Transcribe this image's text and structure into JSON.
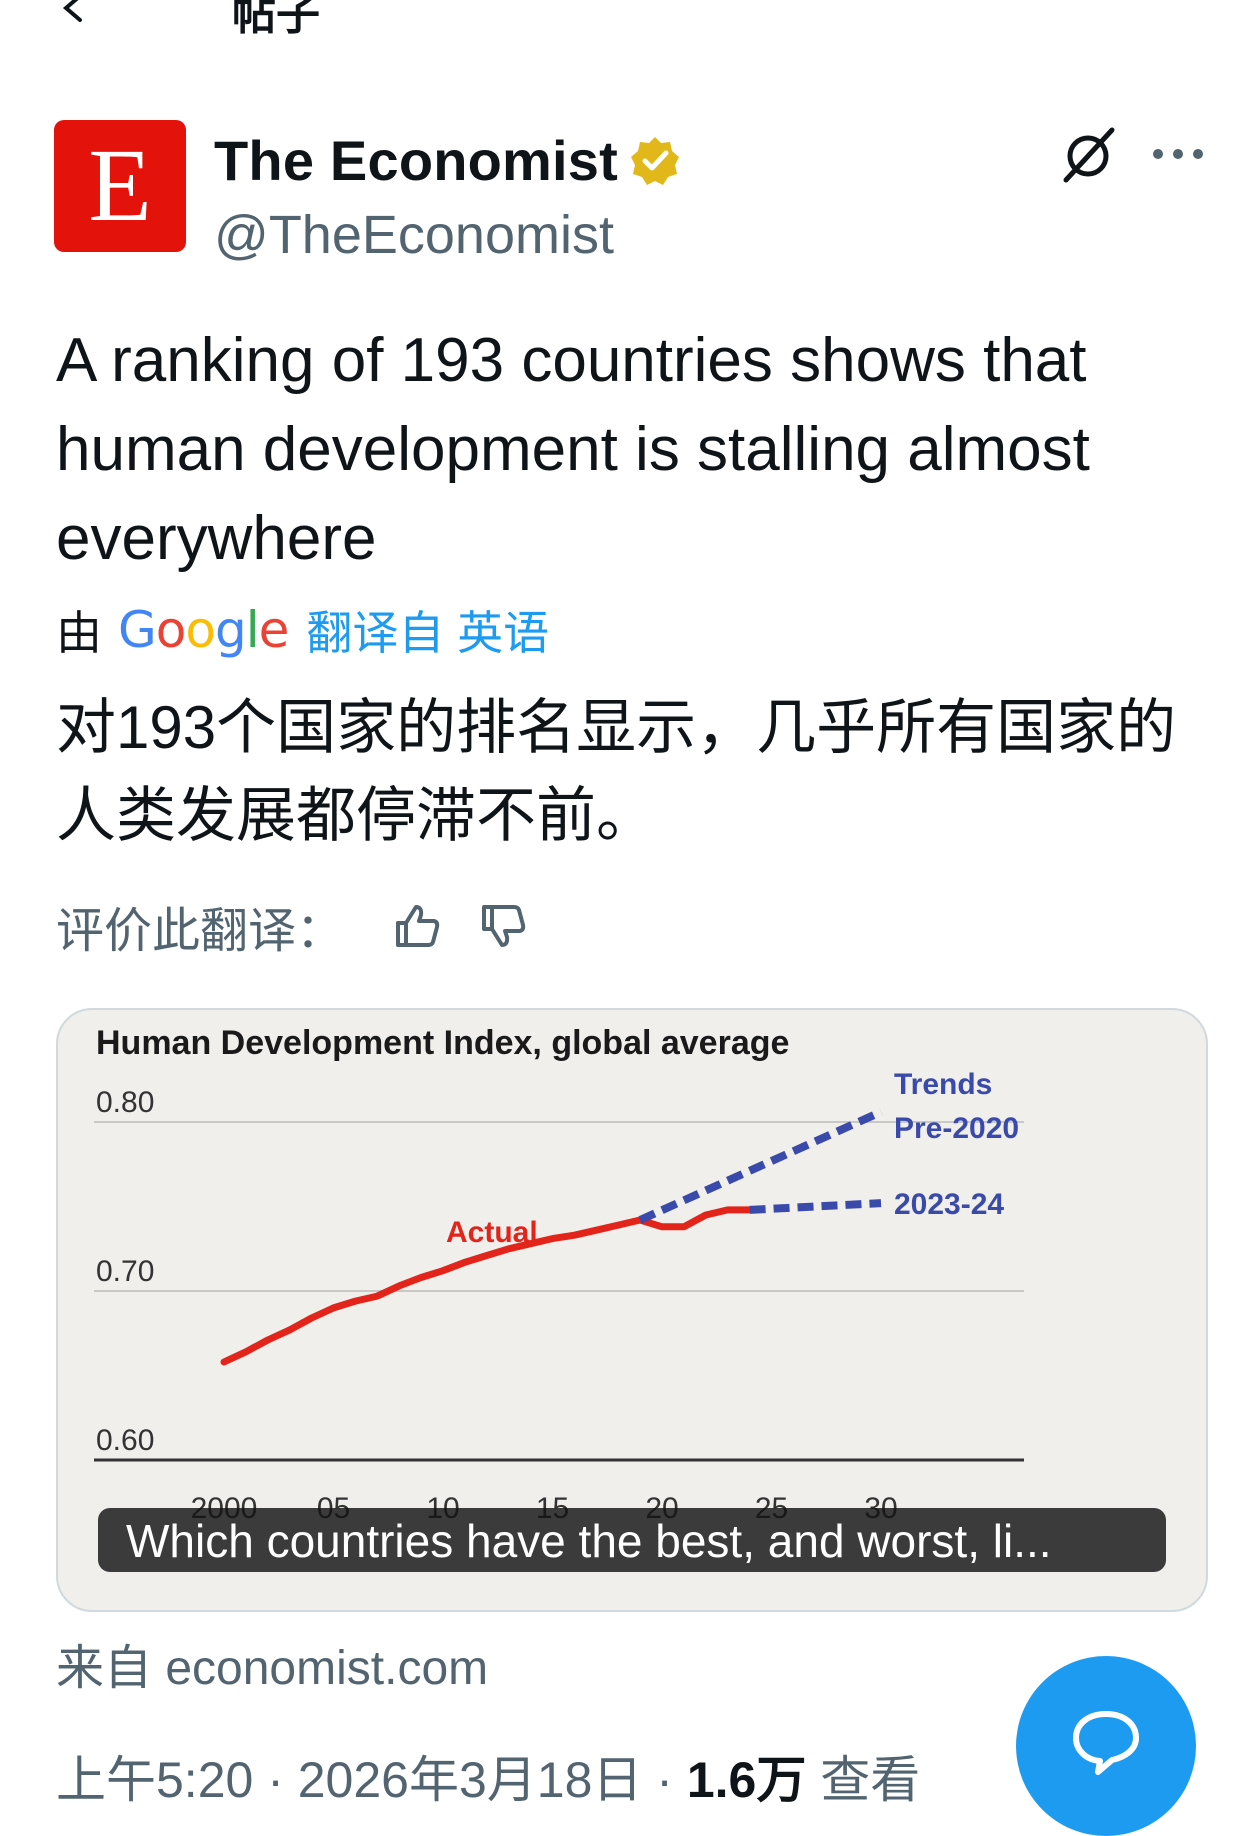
{
  "topbar": {
    "title": "帖子"
  },
  "author": {
    "avatar_letter": "E",
    "display_name": "The Economist",
    "handle": "@TheEconomist",
    "brand_color": "#e3120b",
    "verified_color": "#e2b719"
  },
  "tweet": {
    "text": "A ranking of 193 countries shows that human development is stalling almost everywhere"
  },
  "translation": {
    "by_label": "由",
    "provider_logo": "Google",
    "from_label": "翻译自 英语",
    "text": "对193个国家的排名显示，几乎所有国家的人类发展都停滞不前。",
    "rate_label": "评价此翻译："
  },
  "card": {
    "caption": "Which countries have the best, and worst, li...",
    "source_label": "来自 economist.com"
  },
  "chart_data": {
    "type": "line",
    "title": "Human Development Index, global average",
    "x_tick_labels": [
      "2000",
      "05",
      "10",
      "15",
      "20",
      "25",
      "30"
    ],
    "y_tick_labels": [
      "0.80",
      "0.70",
      "0.60"
    ],
    "xlim": [
      1999,
      2031
    ],
    "ylim": [
      0.6,
      0.8
    ],
    "legend_heading": "Trends",
    "series": [
      {
        "name": "Actual",
        "color": "#e3241b",
        "style": "solid",
        "points": [
          [
            2000,
            0.658
          ],
          [
            2001,
            0.664
          ],
          [
            2002,
            0.671
          ],
          [
            2003,
            0.677
          ],
          [
            2004,
            0.684
          ],
          [
            2005,
            0.69
          ],
          [
            2006,
            0.694
          ],
          [
            2007,
            0.697
          ],
          [
            2008,
            0.703
          ],
          [
            2009,
            0.708
          ],
          [
            2010,
            0.712
          ],
          [
            2011,
            0.717
          ],
          [
            2012,
            0.721
          ],
          [
            2013,
            0.725
          ],
          [
            2014,
            0.728
          ],
          [
            2015,
            0.731
          ],
          [
            2016,
            0.733
          ],
          [
            2017,
            0.736
          ],
          [
            2018,
            0.739
          ],
          [
            2019,
            0.742
          ],
          [
            2020,
            0.738
          ],
          [
            2021,
            0.738
          ],
          [
            2022,
            0.745
          ],
          [
            2023,
            0.748
          ],
          [
            2024,
            0.748
          ]
        ]
      },
      {
        "name": "Pre-2020",
        "color": "#3a4aaa",
        "style": "dashed",
        "points": [
          [
            2019,
            0.742
          ],
          [
            2030,
            0.806
          ]
        ]
      },
      {
        "name": "2023-24",
        "color": "#3a4aaa",
        "style": "dashed",
        "points": [
          [
            2024,
            0.748
          ],
          [
            2030,
            0.752
          ]
        ]
      }
    ]
  },
  "footer": {
    "timestamp": "上午5:20 · 2026年3月18日 · ",
    "views_count": "1.6万",
    "views_label": " 查看"
  },
  "fab": {
    "color": "#1d9bf0"
  }
}
